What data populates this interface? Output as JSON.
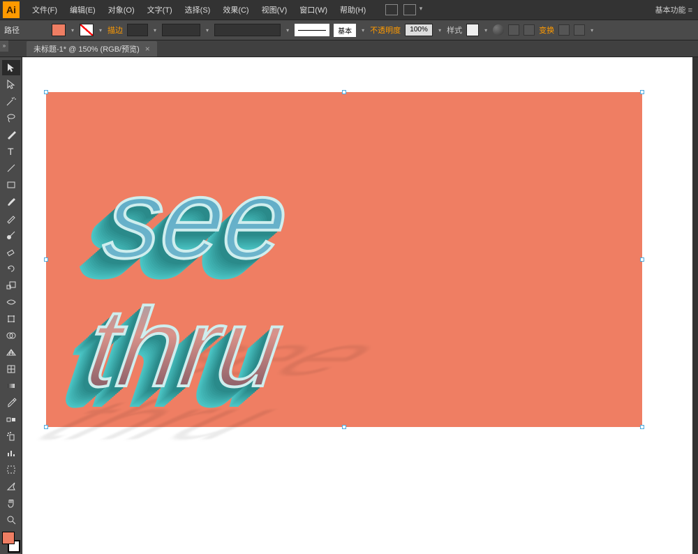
{
  "app": {
    "logo_text": "Ai"
  },
  "menu": {
    "file": "文件(F)",
    "edit": "编辑(E)",
    "object": "对象(O)",
    "type": "文字(T)",
    "select": "选择(S)",
    "effect": "效果(C)",
    "view": "视图(V)",
    "window": "窗口(W)",
    "help": "帮助(H)"
  },
  "workspace_label": "基本功能",
  "controlbar": {
    "selection_label": "路径",
    "stroke_label": "描边",
    "profile_label": "基本",
    "opacity_label": "不透明度",
    "opacity_value": "100%",
    "style_label": "样式",
    "transform_label": "变换",
    "fill_color": "#ef7e63"
  },
  "document": {
    "tab_title": "未标题-1* @ 150% (RGB/预览)"
  },
  "artboard": {
    "bg_color": "#ef7e63",
    "text": "see thru"
  },
  "icons": {
    "close": "×",
    "dropdown": "▾"
  },
  "tools": [
    "selection",
    "direct-select",
    "magic-wand",
    "lasso",
    "pen",
    "type",
    "line",
    "rectangle",
    "paintbrush",
    "pencil",
    "blob-brush",
    "eraser",
    "rotate",
    "scale",
    "width",
    "free-transform",
    "shape-builder",
    "perspective",
    "mesh",
    "gradient",
    "eyedropper",
    "blend",
    "symbol-spray",
    "column-graph",
    "artboard",
    "slice",
    "hand",
    "zoom"
  ]
}
